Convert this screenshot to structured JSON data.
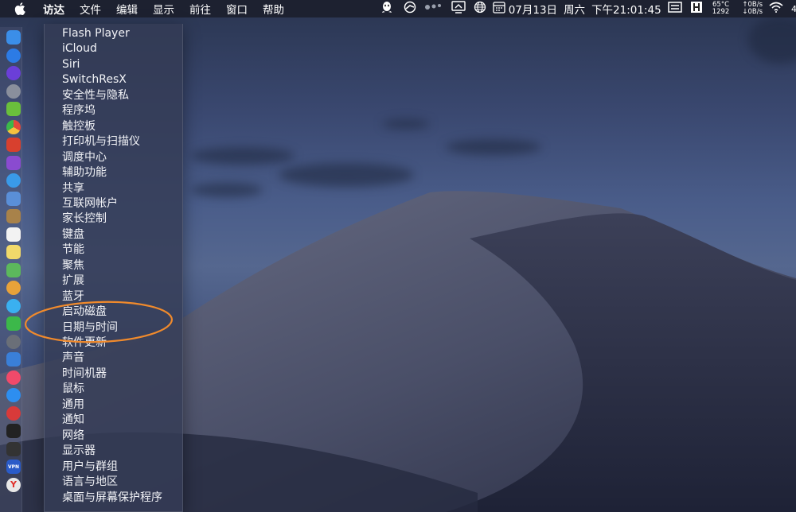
{
  "menubar": {
    "menus": [
      "访达",
      "文件",
      "编辑",
      "显示",
      "前往",
      "窗口",
      "帮助"
    ],
    "date": "07月13日",
    "weekday": "周六",
    "time": "下午21:01:45",
    "cpu_temp": "65°C",
    "fan_rpm": "1292",
    "net_up": "↑0B/s",
    "net_down": "↓0B/s",
    "edge_text": "4"
  },
  "dropdown": {
    "items": [
      "Flash Player",
      "iCloud",
      "Siri",
      "SwitchResX",
      "安全性与隐私",
      "程序坞",
      "触控板",
      "打印机与扫描仪",
      "调度中心",
      "辅助功能",
      "共享",
      "互联网帐户",
      "家长控制",
      "键盘",
      "节能",
      "聚焦",
      "扩展",
      "蓝牙",
      "启动磁盘",
      "日期与时间",
      "软件更新",
      "声音",
      "时间机器",
      "鼠标",
      "通用",
      "通知",
      "网络",
      "显示器",
      "用户与群组",
      "语言与地区",
      "桌面与屏幕保护程序"
    ]
  },
  "dock": {
    "icons": [
      {
        "name": "finder-icon",
        "color": "#3b8ee8"
      },
      {
        "name": "app-store-icon",
        "color": "#2c7be5"
      },
      {
        "name": "siri-icon",
        "color": "#6b3fd8"
      },
      {
        "name": "launchpad-icon",
        "color": "#8a8f9c"
      },
      {
        "name": "android-icon",
        "color": "#6abf3c"
      },
      {
        "name": "chrome-icon",
        "color": "#e24a3b"
      },
      {
        "name": "toolbox-icon",
        "color": "#d8402e"
      },
      {
        "name": "calculator-icon",
        "color": "#8a4bd0"
      },
      {
        "name": "safari-icon",
        "color": "#3a9ae8"
      },
      {
        "name": "preview-icon",
        "color": "#5a8fd8"
      },
      {
        "name": "notes-brown-icon",
        "color": "#a8824a"
      },
      {
        "name": "calendar-icon",
        "color": "#f2f2f2"
      },
      {
        "name": "notes-icon",
        "color": "#f1d96a"
      },
      {
        "name": "maps-icon",
        "color": "#5cb85c"
      },
      {
        "name": "photos-icon",
        "color": "#e8a23a"
      },
      {
        "name": "messages-icon",
        "color": "#3ab0f0"
      },
      {
        "name": "wechat-icon",
        "color": "#3cb84a"
      },
      {
        "name": "system-preferences-icon",
        "color": "#6a6f78"
      },
      {
        "name": "keynote-icon",
        "color": "#3a7fd8"
      },
      {
        "name": "music-icon",
        "color": "#f04a6a"
      },
      {
        "name": "app-store-2-icon",
        "color": "#2d8ef0"
      },
      {
        "name": "vivaldi-icon",
        "color": "#d83a3a"
      },
      {
        "name": "terminal-icon",
        "color": "#222"
      },
      {
        "name": "activity-monitor-icon",
        "color": "#333"
      },
      {
        "name": "vpn-icon",
        "color": "#2a5bc8",
        "label": "VPN"
      },
      {
        "name": "yandex-icon",
        "color": "#e8e8e8",
        "label": "Y"
      }
    ]
  },
  "annotation": {
    "color": "#f08a2c"
  }
}
